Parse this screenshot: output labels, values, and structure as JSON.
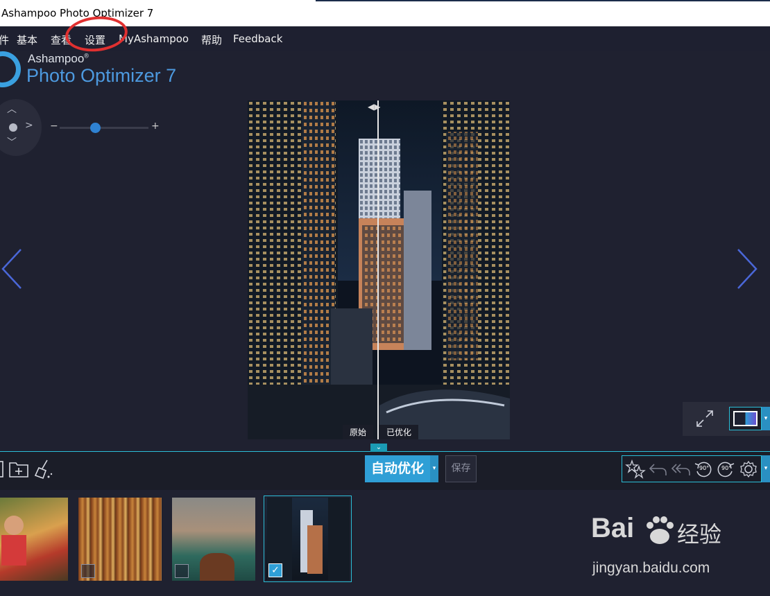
{
  "window": {
    "title": "Ashampoo Photo Optimizer 7"
  },
  "menu": {
    "items": [
      "件",
      "基本",
      "查看",
      "设置",
      "MyAshampoo",
      "帮助",
      "Feedback"
    ]
  },
  "logo": {
    "brand": "Ashampoo",
    "registered": "®",
    "product": "Photo Optimizer 7"
  },
  "zoom": {
    "minus": "−",
    "plus": "+",
    "level": 0.4
  },
  "compare": {
    "original_label": "原始",
    "optimized_label": "已优化"
  },
  "toolbar": {
    "auto_optimize_label": "自动优化",
    "save_label": "保存",
    "rotate_left_label": "90°",
    "rotate_right_label": "90°"
  },
  "thumbnails": [
    {
      "name": "child-photo",
      "checked": false
    },
    {
      "name": "bookshelf-photo",
      "checked": false
    },
    {
      "name": "venice-canal-photo",
      "checked": false
    },
    {
      "name": "city-night-photo",
      "checked": true,
      "selected": true
    }
  ],
  "watermark": {
    "brand": "Bai",
    "brand_cn": "经验",
    "url": "jingyan.baidu.com"
  },
  "colors": {
    "accent": "#2f9fd6",
    "highlight": "#2bbfd8",
    "background": "#1f2130",
    "annotation": "#e03030"
  }
}
